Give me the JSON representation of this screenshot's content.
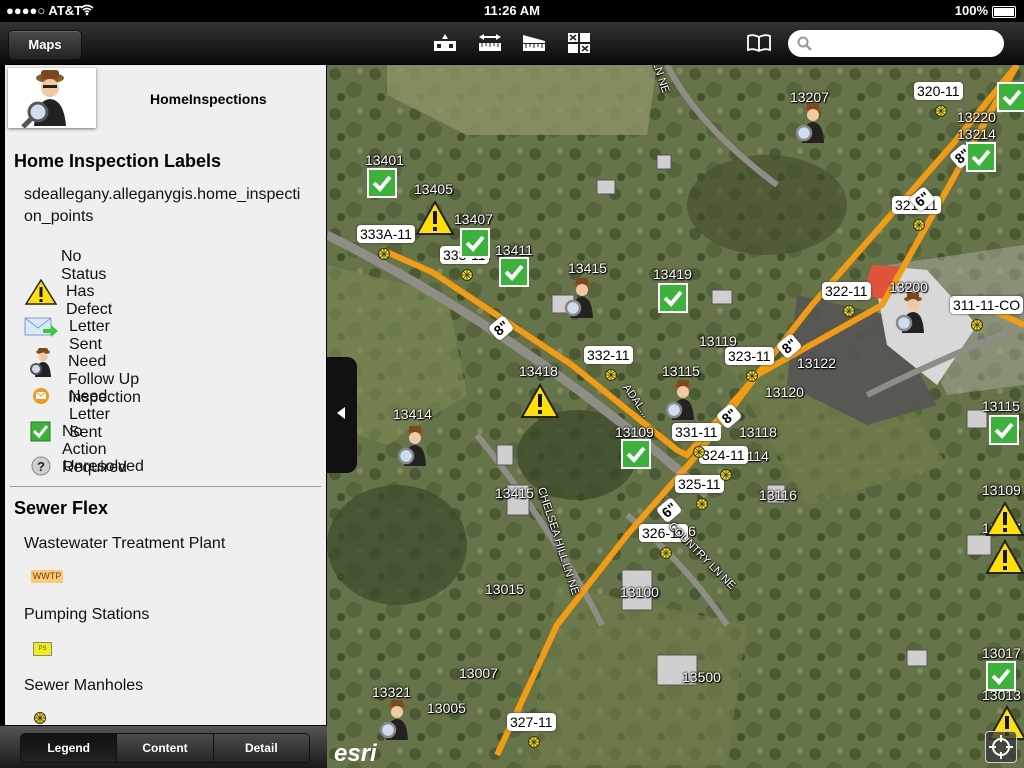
{
  "status": {
    "carrier": "●●●●○ AT&T",
    "time": "11:26 AM",
    "battery": "100%"
  },
  "toolbar": {
    "maps_label": "Maps",
    "search_placeholder": ""
  },
  "layer": {
    "title": "HomeInspections"
  },
  "legend": {
    "section1_title": "Home Inspection Labels",
    "service_name": "sdeallegany.alleganygis.home_inspection_points",
    "items": [
      {
        "label": "No Status",
        "icon": "none"
      },
      {
        "label": "Has Defect",
        "icon": "warning-icon"
      },
      {
        "label": "Letter Sent",
        "icon": "envelope-arrow-icon"
      },
      {
        "label": "Need Follow Up Inspection",
        "icon": "inspector-icon"
      },
      {
        "label": "Need Letter Sent",
        "icon": "orange-envelope-icon"
      },
      {
        "label": "No Action Required",
        "icon": "green-check-icon"
      },
      {
        "label": "Unresolved",
        "icon": "question-icon"
      }
    ],
    "section2_title": "Sewer Flex",
    "sewer": [
      {
        "label": "Wastewater Treatment Plant",
        "symbol_text": "WWTP"
      },
      {
        "label": "Pumping Stations",
        "symbol_text": "PS"
      },
      {
        "label": "Sewer Manholes",
        "symbol_text": ""
      }
    ]
  },
  "tabs": [
    {
      "label": "Legend",
      "active": true
    },
    {
      "label": "Content",
      "active": false
    },
    {
      "label": "Detail",
      "active": false
    }
  ],
  "map": {
    "attribution": "esri",
    "roads": [
      {
        "name": "FIELD LN NE"
      },
      {
        "name": "ADAL..."
      },
      {
        "name": "CHELSEA HILL LN NE"
      },
      {
        "name": "COUNTRY LN NE"
      }
    ],
    "parcel_labels": [
      "13207",
      "13220",
      "13214",
      "13401",
      "13405",
      "13407",
      "13411",
      "13415",
      "13419",
      "13200",
      "13119",
      "13122",
      "13418",
      "13115",
      "13120",
      "13414",
      "13109",
      "13118",
      "13114",
      "13116",
      "13415",
      "13106",
      "13100",
      "13015",
      "13007",
      "13005",
      "13321",
      "13500",
      "13115",
      "13109",
      "13107",
      "13017",
      "13013"
    ],
    "manhole_labels": [
      "320-11",
      "321-11",
      "333A-11",
      "333-11",
      "322-11",
      "311-11-CO",
      "332-11",
      "323-11",
      "331-11",
      "324-11",
      "325-11",
      "326-11",
      "327-11"
    ],
    "pipe_size_labels": [
      "8\"",
      "6\"",
      "8\"",
      "8\"",
      "8\"",
      "6\""
    ]
  }
}
